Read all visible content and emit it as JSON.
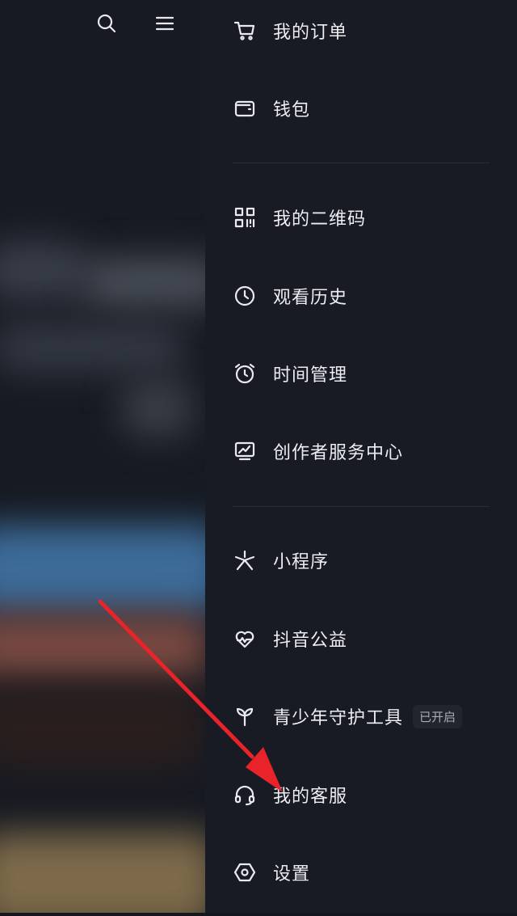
{
  "menu": {
    "items": [
      {
        "label": "我的订单",
        "icon": "cart-icon"
      },
      {
        "label": "钱包",
        "icon": "wallet-icon"
      },
      {
        "label": "我的二维码",
        "icon": "qr-code-icon"
      },
      {
        "label": "观看历史",
        "icon": "clock-icon"
      },
      {
        "label": "时间管理",
        "icon": "alarm-clock-icon"
      },
      {
        "label": "创作者服务中心",
        "icon": "chart-icon"
      },
      {
        "label": "小程序",
        "icon": "mini-program-icon"
      },
      {
        "label": "抖音公益",
        "icon": "heart-icon"
      },
      {
        "label": "青少年守护工具",
        "icon": "sprout-icon",
        "badge": "已开启"
      },
      {
        "label": "我的客服",
        "icon": "headset-icon"
      },
      {
        "label": "设置",
        "icon": "hexagon-settings-icon"
      }
    ]
  },
  "top_icons": [
    "search-icon",
    "menu-icon"
  ],
  "colors": {
    "drawer_bg": "#181b24",
    "annotation_arrow": "#e8232a"
  }
}
